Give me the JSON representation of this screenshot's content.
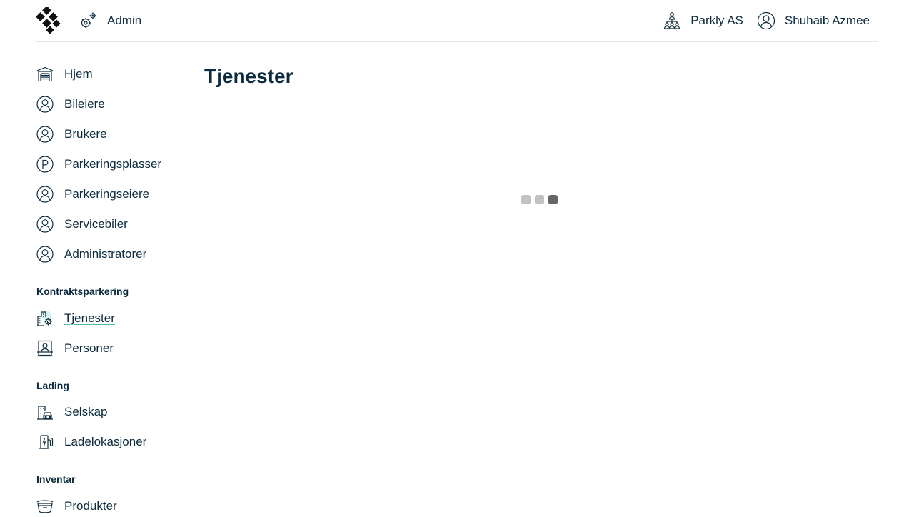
{
  "header": {
    "admin_label": "Admin",
    "organization_label": "Parkly AS",
    "user_name": "Shuhaib Azmee"
  },
  "sidebar": {
    "items": [
      {
        "label": "Hjem",
        "icon": "garage-icon"
      },
      {
        "label": "Bileiere",
        "icon": "user-circle-icon"
      },
      {
        "label": "Brukere",
        "icon": "user-circle-icon"
      },
      {
        "label": "Parkeringsplasser",
        "icon": "parking-p-icon"
      },
      {
        "label": "Parkeringseiere",
        "icon": "user-circle-icon"
      },
      {
        "label": "Servicebiler",
        "icon": "user-circle-icon"
      },
      {
        "label": "Administratorer",
        "icon": "user-circle-icon"
      }
    ],
    "sections": [
      {
        "title": "Kontraktsparkering",
        "items": [
          {
            "label": "Tjenester",
            "icon": "building-gear-icon",
            "active": true
          },
          {
            "label": "Personer",
            "icon": "person-desk-icon"
          }
        ]
      },
      {
        "title": "Lading",
        "items": [
          {
            "label": "Selskap",
            "icon": "building-car-icon"
          },
          {
            "label": "Ladelokasjoner",
            "icon": "charging-station-icon"
          }
        ]
      },
      {
        "title": "Inventar",
        "items": [
          {
            "label": "Produkter",
            "icon": "box-icon"
          }
        ]
      }
    ]
  },
  "main": {
    "title": "Tjenester",
    "loading": true
  },
  "colors": {
    "text": "#0d2b3e",
    "accent": "#4cb8ac",
    "border": "#e3e6e8",
    "loader_light": "#c2c2c2",
    "loader_dark": "#666666"
  }
}
